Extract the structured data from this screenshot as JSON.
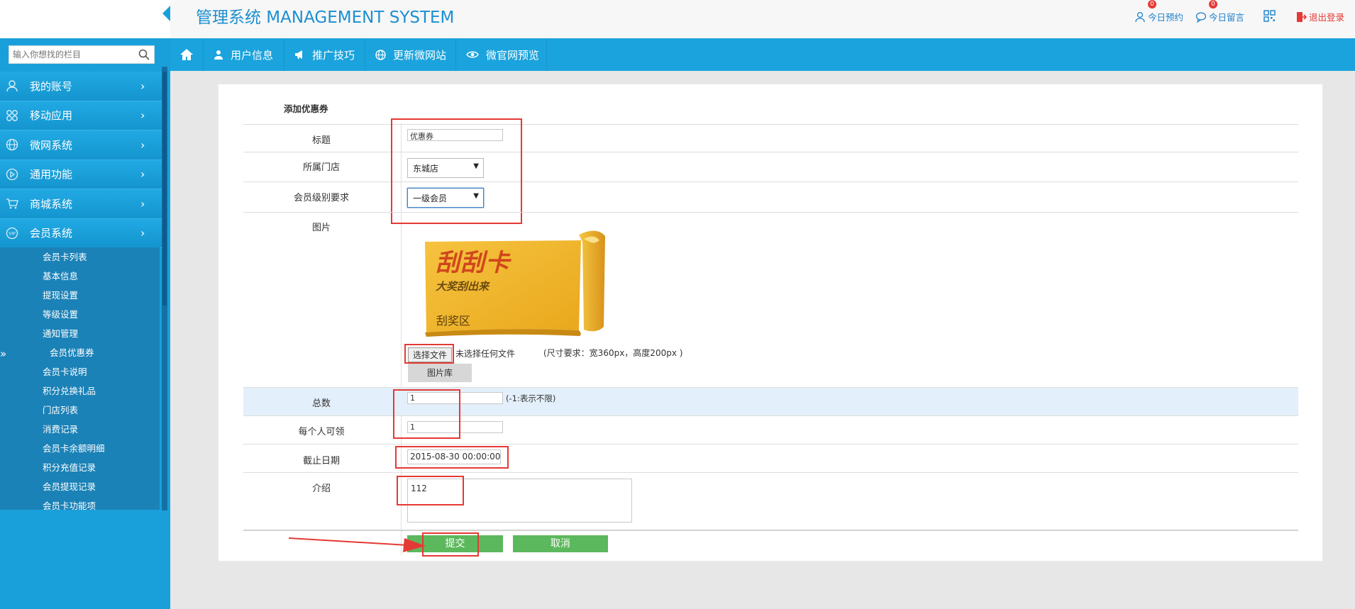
{
  "app": {
    "title": "管理系统 MANAGEMENT SYSTEM"
  },
  "header": {
    "appointments": {
      "badge": "0",
      "label": "今日预约"
    },
    "messages": {
      "badge": "0",
      "label": "今日留言"
    },
    "logout": "退出登录"
  },
  "sidebar": {
    "search_placeholder": "输入你想找的栏目",
    "items": [
      {
        "label": "我的账号",
        "icon": "user-icon"
      },
      {
        "label": "移动应用",
        "icon": "apps-icon"
      },
      {
        "label": "微网系统",
        "icon": "globe-icon"
      },
      {
        "label": "通用功能",
        "icon": "play-icon"
      },
      {
        "label": "商城系统",
        "icon": "cart-icon"
      },
      {
        "label": "会员系统",
        "icon": "vip-icon"
      }
    ],
    "submenu": [
      "会员卡列表",
      "基本信息",
      "提现设置",
      "等级设置",
      "通知管理",
      "会员优惠券",
      "会员卡说明",
      "积分兑换礼品",
      "门店列表",
      "消费记录",
      "会员卡余额明细",
      "积分充值记录",
      "会员提现记录",
      "会员卡功能项"
    ],
    "collapse": "»"
  },
  "topnav": {
    "home_icon": "home-icon",
    "items": [
      {
        "label": "用户信息",
        "icon": "user-icon"
      },
      {
        "label": "推广技巧",
        "icon": "megaphone-icon"
      },
      {
        "label": "更新微网站",
        "icon": "globe-icon"
      },
      {
        "label": "微官网预览",
        "icon": "eye-icon"
      }
    ]
  },
  "form": {
    "heading": "添加优惠券",
    "labels": {
      "title": "标题",
      "store": "所属门店",
      "level": "会员级别要求",
      "image": "图片",
      "total": "总数",
      "per_person": "每个人可领",
      "deadline": "截止日期",
      "intro": "介绍"
    },
    "values": {
      "title": "优惠券",
      "store": "东城店",
      "level": "一级会员",
      "total": "1",
      "per_person": "1",
      "deadline": "2015-08-30 00:00:00",
      "intro": "112"
    },
    "total_hint": "(-1:表示不限)",
    "file_button": "选择文件",
    "file_status": "未选择任何文件",
    "size_hint": "(尺寸要求：宽360px，高度200px )",
    "gallery_button": "图片库",
    "submit": "提交",
    "cancel": "取消"
  },
  "card": {
    "title": "刮刮卡",
    "subtitle": "大奖刮出来",
    "area": "刮奖区"
  },
  "colors": {
    "sidebar": "#19a0db",
    "topnav": "#1aa3dd",
    "submenu": "#1b82b7",
    "accent_green": "#5cb85c",
    "annotation_red": "#e53935",
    "title_blue": "#1c8fd1"
  }
}
